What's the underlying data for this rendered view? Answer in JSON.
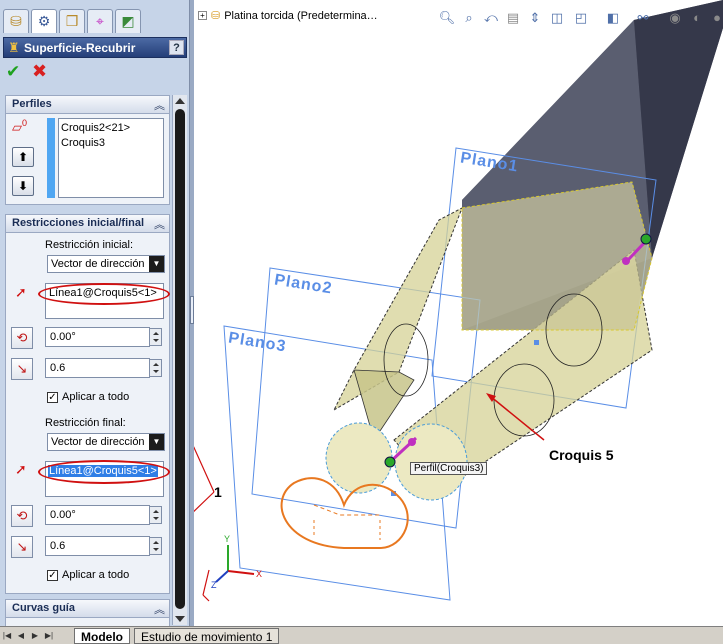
{
  "property_manager": {
    "tabs": [
      {
        "icon": "feature-manager-icon",
        "glyph": "⛁"
      },
      {
        "icon": "property-manager-icon",
        "glyph": "⚙"
      },
      {
        "icon": "configuration-manager-icon",
        "glyph": "❒"
      },
      {
        "icon": "dimxpert-icon",
        "glyph": "⌖"
      },
      {
        "icon": "display-manager-icon",
        "glyph": "◩"
      }
    ],
    "title": "Superficie-Recubrir",
    "help_label": "?",
    "ok_glyph": "✔",
    "cancel_glyph": "✖",
    "profiles": {
      "header": "Perfiles",
      "items": [
        "Croquis2<21>",
        "Croquis3"
      ],
      "profile_icon_badge": "0",
      "move_up_glyph": "⬆",
      "move_down_glyph": "⬇"
    },
    "constraints": {
      "header": "Restricciones inicial/final",
      "start_label": "Restricción inicial:",
      "start_type": "Vector de dirección",
      "start_vector": "Línea1@Croquis5<1>",
      "start_angle": "0.00°",
      "start_length": "0.6",
      "start_apply_all": "Aplicar a todo",
      "end_label": "Restricción final:",
      "end_type": "Vector de dirección",
      "end_vector": "Línea1@Croquis5<1>",
      "end_angle": "0.00°",
      "end_length": "0.6",
      "end_apply_all": "Aplicar a todo"
    },
    "guide_curves": {
      "header": "Curvas guía"
    }
  },
  "viewport": {
    "tree_item": "Platina torcida  (Predetermina…",
    "planes": [
      "Plano1",
      "Plano2",
      "Plano3"
    ],
    "tooltip": "Perfil(Croquis3)",
    "callout_sketch": "Croquis 5",
    "callout_number": "1",
    "triad": {
      "x": "X",
      "y": "Y",
      "z": "Z"
    }
  },
  "bottom_tabs": [
    "Modelo",
    "Estudio de movimiento 1"
  ],
  "colors": {
    "plane": "#5a8ee6",
    "surface": "#d6d296",
    "sketch": "#e87820",
    "annotation_red": "#d01010",
    "solid_body": "#4a4d5e"
  }
}
